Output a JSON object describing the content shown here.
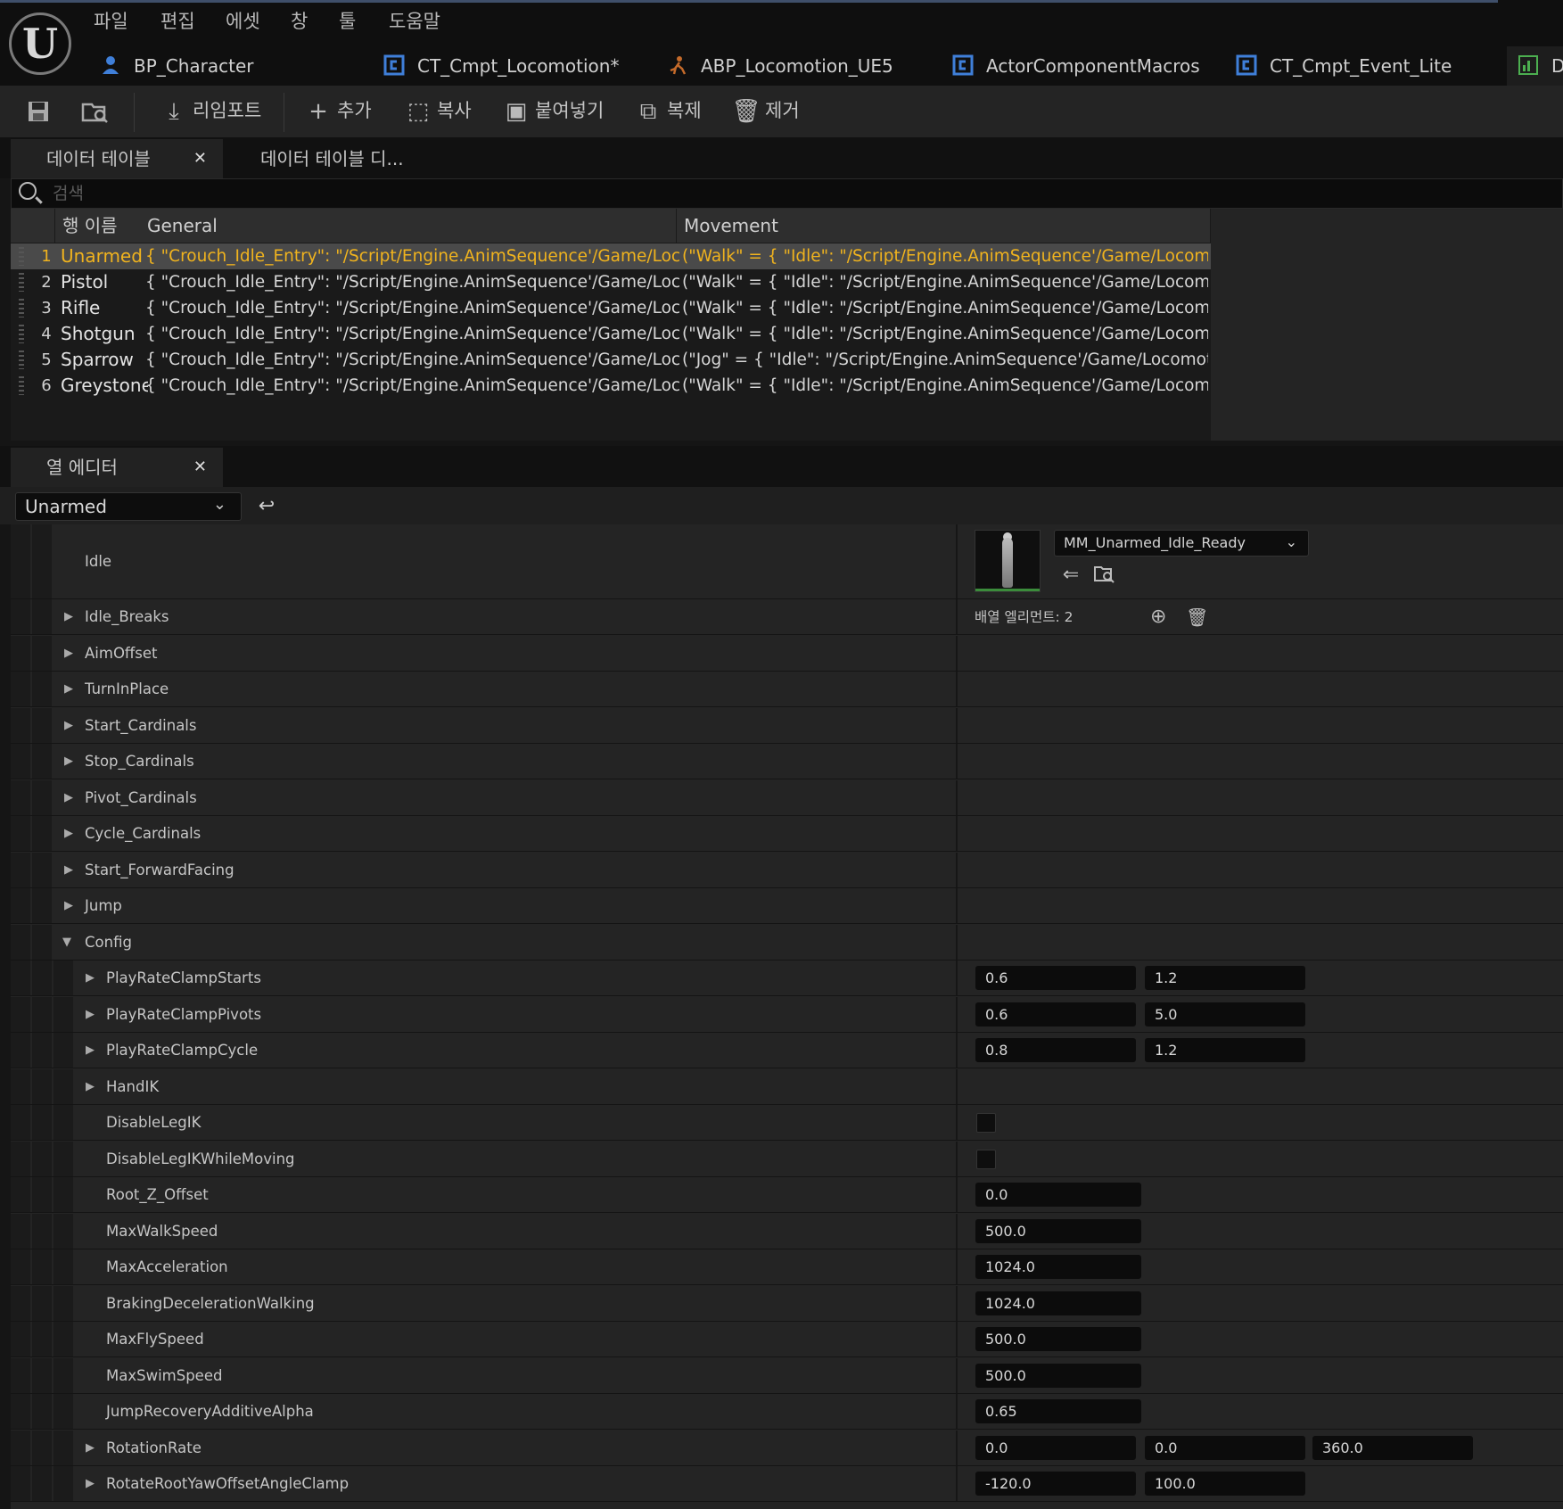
{
  "menu": [
    "파일",
    "편집",
    "에셋",
    "창",
    "툴",
    "도움말"
  ],
  "doc_tabs": [
    {
      "label": "BP_Character",
      "icon": "character-blueprint-icon"
    },
    {
      "label": "CT_Cmpt_Locomotion*",
      "icon": "blueprint-class-icon"
    },
    {
      "label": "ABP_Locomotion_UE5",
      "icon": "animation-blueprint-icon"
    },
    {
      "label": "ActorComponentMacros",
      "icon": "blueprint-class-icon"
    },
    {
      "label": "CT_Cmpt_Event_Lite",
      "icon": "blueprint-class-icon"
    },
    {
      "label": "D",
      "icon": "data-table-icon"
    }
  ],
  "toolbar": {
    "reimport": "리임포트",
    "add": "추가",
    "copy": "복사",
    "paste": "붙여넣기",
    "duplicate": "복제",
    "remove": "제거"
  },
  "panel_tabs": {
    "data_table": "데이터 테이블",
    "data_table_diff": "데이터 테이블 디...",
    "row_editor": "열 에디터"
  },
  "search": {
    "placeholder": "검색",
    "value": ""
  },
  "table": {
    "headers": [
      "행 이름",
      "General",
      "Movement"
    ],
    "rows": [
      {
        "num": "1",
        "name": "Unarmed",
        "general": "{ \"Crouch_Idle_Entry\": \"/Script/Engine.AnimSequence'/Game/LocomotionS",
        "movement": "(\"Walk\" = { \"Idle\": \"/Script/Engine.AnimSequence'/Game/LocomotionSyste",
        "selected": true
      },
      {
        "num": "2",
        "name": "Pistol",
        "general": "{ \"Crouch_Idle_Entry\": \"/Script/Engine.AnimSequence'/Game/LocomotionS",
        "movement": "(\"Walk\" = { \"Idle\": \"/Script/Engine.AnimSequence'/Game/LocomotionSyste"
      },
      {
        "num": "3",
        "name": "Rifle",
        "general": "{ \"Crouch_Idle_Entry\": \"/Script/Engine.AnimSequence'/Game/LocomotionS",
        "movement": "(\"Walk\" = { \"Idle\": \"/Script/Engine.AnimSequence'/Game/LocomotionSyste"
      },
      {
        "num": "4",
        "name": "Shotgun",
        "general": "{ \"Crouch_Idle_Entry\": \"/Script/Engine.AnimSequence'/Game/LocomotionS",
        "movement": "(\"Walk\" = { \"Idle\": \"/Script/Engine.AnimSequence'/Game/LocomotionSyste"
      },
      {
        "num": "5",
        "name": "Sparrow",
        "general": "{ \"Crouch_Idle_Entry\": \"/Script/Engine.AnimSequence'/Game/LocomotionS",
        "movement": "(\"Jog\" = { \"Idle\": \"/Script/Engine.AnimSequence'/Game/LocomotionSystem"
      },
      {
        "num": "6",
        "name": "Greystone",
        "general": "{ \"Crouch_Idle_Entry\": \"/Script/Engine.AnimSequence'/Game/LocomotionS",
        "movement": "(\"Walk\" = { \"Idle\": \"/Script/Engine.AnimSequence'/Game/LocomotionSyste"
      }
    ]
  },
  "row_editor": {
    "selected_row": "Unarmed",
    "idle_label": "Idle",
    "idle_asset": "MM_Unarmed_Idle_Ready",
    "array_elements": "배열 엘리먼트: 2",
    "categories": [
      "Idle_Breaks",
      "AimOffset",
      "TurnInPlace",
      "Start_Cardinals",
      "Stop_Cardinals",
      "Pivot_Cardinals",
      "Cycle_Cardinals",
      "Start_ForwardFacing",
      "Jump"
    ],
    "config_label": "Config",
    "config": [
      {
        "label": "PlayRateClampStarts",
        "expand": true,
        "values": [
          "0.6",
          "1.2"
        ]
      },
      {
        "label": "PlayRateClampPivots",
        "expand": true,
        "values": [
          "0.6",
          "5.0"
        ]
      },
      {
        "label": "PlayRateClampCycle",
        "expand": true,
        "values": [
          "0.8",
          "1.2"
        ]
      },
      {
        "label": "HandIK",
        "expand": true,
        "values": []
      },
      {
        "label": "DisableLegIK",
        "checkbox": true,
        "checked": false
      },
      {
        "label": "DisableLegIKWhileMoving",
        "checkbox": true,
        "checked": false
      },
      {
        "label": "Root_Z_Offset",
        "values": [
          "0.0"
        ]
      },
      {
        "label": "MaxWalkSpeed",
        "values": [
          "500.0"
        ]
      },
      {
        "label": "MaxAcceleration",
        "values": [
          "1024.0"
        ]
      },
      {
        "label": "BrakingDecelerationWalking",
        "values": [
          "1024.0"
        ]
      },
      {
        "label": "MaxFlySpeed",
        "values": [
          "500.0"
        ]
      },
      {
        "label": "MaxSwimSpeed",
        "values": [
          "500.0"
        ]
      },
      {
        "label": "JumpRecoveryAdditiveAlpha",
        "values": [
          "0.65"
        ]
      },
      {
        "label": "RotationRate",
        "expand": true,
        "values": [
          "0.0",
          "0.0",
          "360.0"
        ]
      },
      {
        "label": "RotateRootYawOffsetAngleClamp",
        "expand": true,
        "values": [
          "-120.0",
          "100.0"
        ]
      }
    ]
  },
  "colors": {
    "selection_text": "#f0b31e",
    "blueprint_icon": "#3f7fd9",
    "background": "#242424"
  }
}
